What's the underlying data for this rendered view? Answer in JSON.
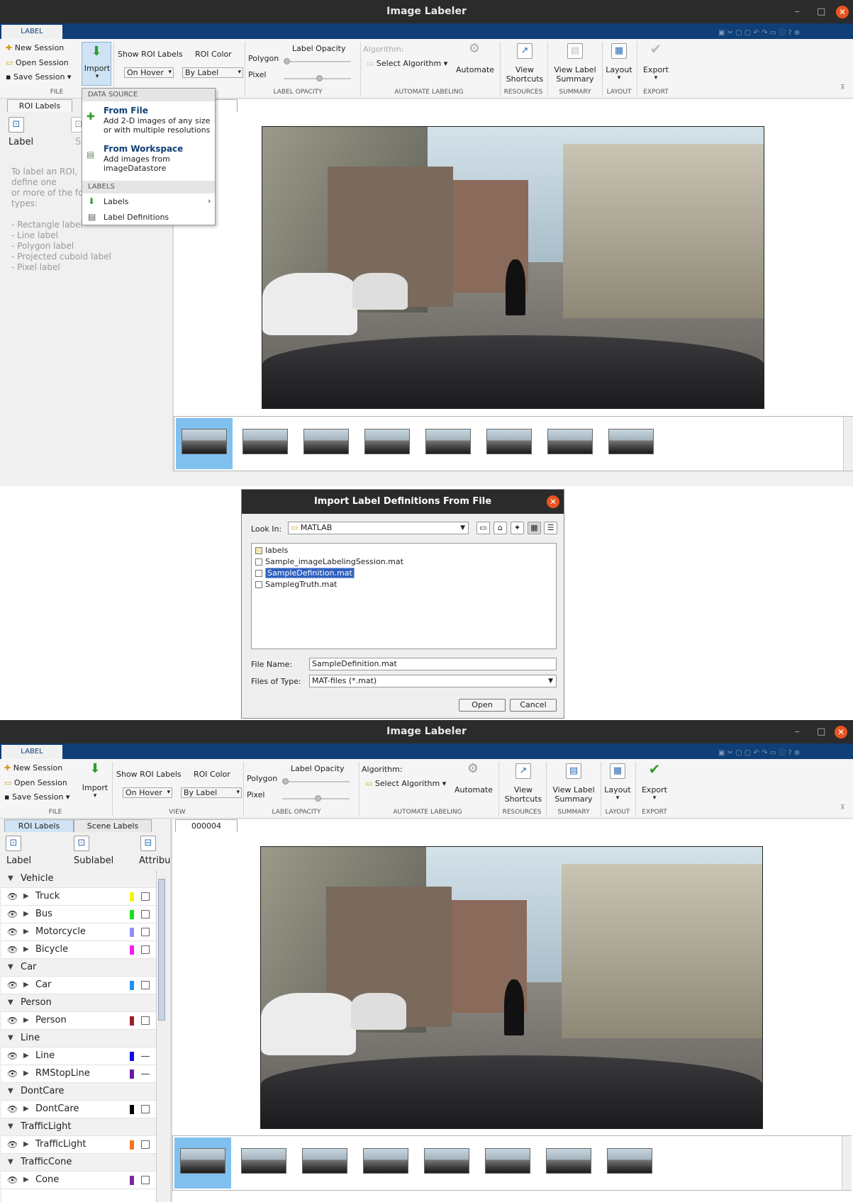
{
  "app": {
    "title": "Image Labeler",
    "tab": "LABEL"
  },
  "window_controls": {
    "minimize": "–",
    "maximize": "□",
    "close": "✕"
  },
  "ribbon": {
    "file": {
      "new_session": "New Session",
      "open_session": "Open Session",
      "save_session": "Save Session",
      "import": "Import",
      "group": "FILE"
    },
    "view": {
      "show_roi_labels": "Show ROI Labels",
      "roi_color": "ROI Color",
      "on_hover": "On Hover",
      "by_label": "By Label",
      "group": "VIEW"
    },
    "opacity": {
      "label_opacity": "Label Opacity",
      "polygon": "Polygon",
      "pixel": "Pixel",
      "group": "LABEL OPACITY"
    },
    "automate": {
      "algorithm": "Algorithm:",
      "select_algorithm": "Select Algorithm",
      "automate": "Automate",
      "group": "AUTOMATE LABELING"
    },
    "resources": {
      "label": "View Shortcuts",
      "line1": "View",
      "line2": "Shortcuts",
      "group": "RESOURCES"
    },
    "summary": {
      "line1": "View Label",
      "line2": "Summary",
      "group": "SUMMARY"
    },
    "layout": {
      "label": "Layout",
      "group": "LAYOUT"
    },
    "export": {
      "label": "Export",
      "group": "EXPORT"
    }
  },
  "panel_tabs": {
    "roi_labels": "ROI Labels",
    "scene_labels": "Scene Labels",
    "image_tab": "000004"
  },
  "panel_tools": {
    "label": "Label",
    "sublabel": "Sublabel",
    "attribute": "Attribu",
    "partial_sublabel": "S"
  },
  "help_text": {
    "lines": [
      "To label an ROI,",
      "define one",
      "or more of the fo",
      "types:"
    ],
    "types": [
      "- Rectangle label",
      "- Line label",
      "- Polygon label",
      "- Projected cuboid label",
      "- Pixel label"
    ]
  },
  "import_menu": {
    "data_source": "DATA SOURCE",
    "from_file_title": "From File",
    "from_file_desc1": "Add 2-D images of any size",
    "from_file_desc2": "or with multiple resolutions",
    "from_ws_title": "From Workspace",
    "from_ws_desc1": "Add images from",
    "from_ws_desc2": "imageDatastore",
    "labels_header": "LABELS",
    "labels": "Labels",
    "label_definitions": "Label Definitions",
    "partial_tab": "4"
  },
  "dialog": {
    "title": "Import Label Definitions From File",
    "look_in_label": "Look In:",
    "look_in_value": "MATLAB",
    "files": [
      {
        "name": "labels",
        "type": "folder"
      },
      {
        "name": "Sample_imageLabelingSession.mat",
        "type": "file"
      },
      {
        "name": "SampleDefinition.mat",
        "type": "file",
        "selected": true
      },
      {
        "name": "SamplegTruth.mat",
        "type": "file"
      }
    ],
    "file_name_label": "File Name:",
    "file_name_value": "SampleDefinition.mat",
    "files_of_type_label": "Files of Type:",
    "files_of_type_value": "MAT-files (*.mat)",
    "open": "Open",
    "cancel": "Cancel"
  },
  "label_tree": [
    {
      "group": "Vehicle"
    },
    {
      "label": "Truck",
      "color": "#f5f500",
      "kind": "rect"
    },
    {
      "label": "Bus",
      "color": "#18e01c",
      "kind": "rect"
    },
    {
      "label": "Motorcycle",
      "color": "#8f8ff5",
      "kind": "rect"
    },
    {
      "label": "Bicycle",
      "color": "#f519f5",
      "kind": "rect"
    },
    {
      "group": "Car"
    },
    {
      "label": "Car",
      "color": "#1e90f5",
      "kind": "rect"
    },
    {
      "group": "Person"
    },
    {
      "label": "Person",
      "color": "#a01c2a",
      "kind": "rect"
    },
    {
      "group": "Line"
    },
    {
      "label": "Line",
      "color": "#0b0bf0",
      "kind": "line"
    },
    {
      "label": "RMStopLine",
      "color": "#6a1aa8",
      "kind": "line"
    },
    {
      "group": "DontCare"
    },
    {
      "label": "DontCare",
      "color": "#000000",
      "kind": "rect"
    },
    {
      "group": "TrafficLight"
    },
    {
      "label": "TrafficLight",
      "color": "#f57420",
      "kind": "rect"
    },
    {
      "group": "TrafficCone"
    },
    {
      "label": "Cone",
      "color": "#7a2a9a",
      "kind": "rect"
    }
  ],
  "thumbnails_count": 8,
  "colors": {
    "accent": "#0f3f76",
    "close": "#e95420",
    "selection": "#7fc0ef",
    "dialog_selection": "#3060c0"
  }
}
